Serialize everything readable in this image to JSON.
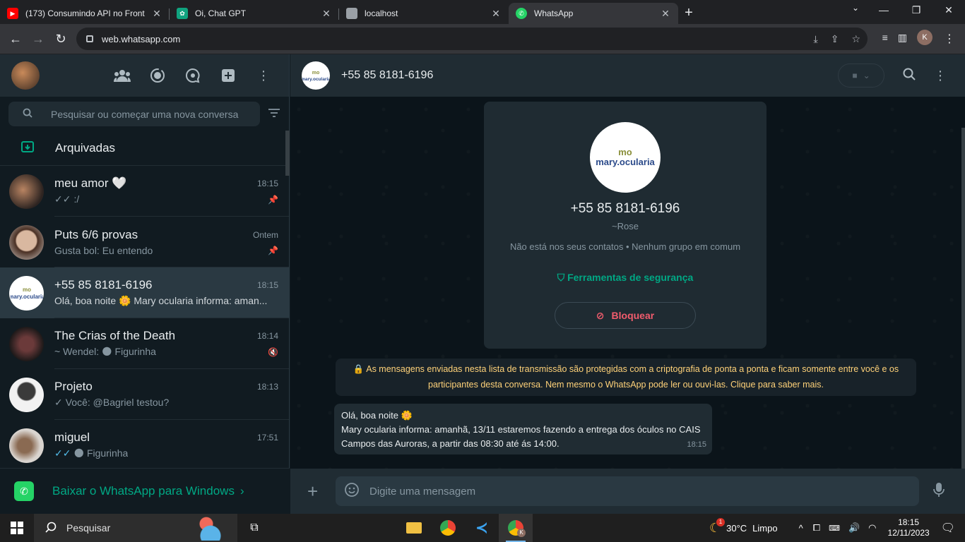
{
  "browser": {
    "tabs": [
      {
        "title": "(173) Consumindo API no Front",
        "icon": "youtube-icon",
        "color": "#ff0000"
      },
      {
        "title": "Oi, Chat GPT",
        "icon": "chatgpt-icon",
        "color": "#10a37f"
      },
      {
        "title": "localhost",
        "icon": "page-icon",
        "color": "#9aa0a6"
      },
      {
        "title": "WhatsApp",
        "icon": "whatsapp-icon",
        "color": "#25d366"
      }
    ],
    "url": "web.whatsapp.com",
    "profile_initial": "K"
  },
  "sidebar": {
    "search_placeholder": "Pesquisar ou começar uma nova conversa",
    "archived_label": "Arquivadas",
    "chats": [
      {
        "name": "meu amor 🤍",
        "time": "18:15",
        "last": ":/",
        "tick": "double",
        "pinned": true
      },
      {
        "name": "Puts 6/6 provas",
        "time": "Ontem",
        "last": "Gusta bol: Eu entendo",
        "tick": "",
        "pinned": true
      },
      {
        "name": "+55 85 8181-6196",
        "time": "18:15",
        "last": "Olá, boa noite 🌼 Mary ocularia informa: aman...",
        "tick": "",
        "pinned": false
      },
      {
        "name": "The Crias of the Death",
        "time": "18:14",
        "last": "~ Wendel: 🌑 Figurinha",
        "tick": "",
        "muted": true
      },
      {
        "name": "Projeto",
        "time": "18:13",
        "last": "Você: @Bagriel testou?",
        "tick": "single"
      },
      {
        "name": "miguel",
        "time": "17:51",
        "last": "🌑 Figurinha",
        "tick": "double-blue"
      }
    ],
    "download_label": "Baixar o WhatsApp para Windows"
  },
  "conversation": {
    "title": "+55 85 8181-6196",
    "card": {
      "logo_top": "mo",
      "logo_text": "mary.ocularia",
      "phone": "+55 85 8181-6196",
      "nickname": "~Rose",
      "info": "Não está nos seus contatos • Nenhum grupo em comum",
      "security": "Ferramentas de segurança",
      "block": "Bloquear"
    },
    "system_message": "As mensagens enviadas nesta lista de transmissão são protegidas com a criptografia de ponta a ponta e ficam somente entre você e os participantes desta conversa. Nem mesmo o WhatsApp pode ler ou ouvi-las. Clique para saber mais.",
    "message": {
      "line1": "Olá, boa noite 🌼",
      "line2": "Mary ocularia informa: amanhã, 13/11 estaremos fazendo a entrega dos óculos no CAIS Campos das Auroras, a partir das 08:30  até ás 14:00.",
      "time": "18:15"
    },
    "composer_placeholder": "Digite uma mensagem"
  },
  "taskbar": {
    "search_label": "Pesquisar",
    "weather_temp": "30°C",
    "weather_desc": "Limpo",
    "weather_badge": "1",
    "time": "18:15",
    "date": "12/11/2023",
    "chrome_badge": "K"
  }
}
